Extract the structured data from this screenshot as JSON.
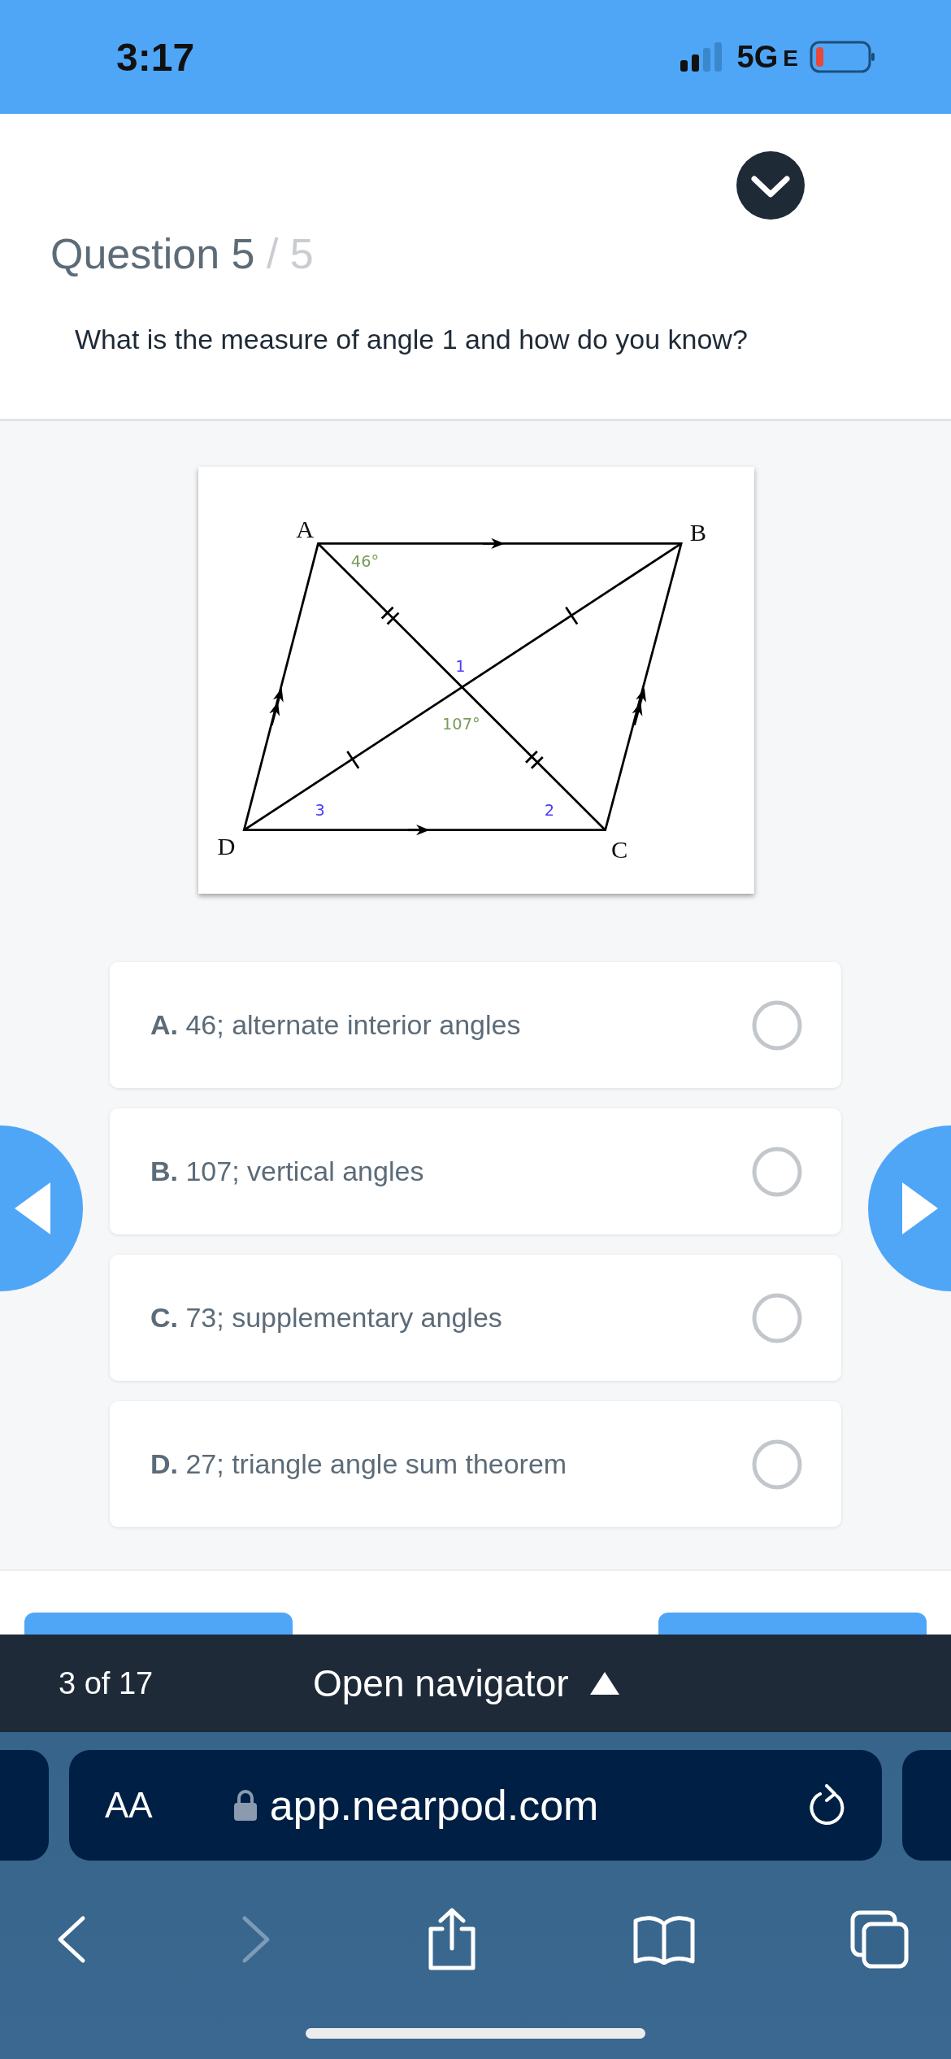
{
  "status_bar": {
    "time": "3:17",
    "network": "5G",
    "network_suffix": "E",
    "battery_low": true
  },
  "question": {
    "title": "Question 5",
    "total": "/ 5",
    "text": "What is the measure of angle 1 and how do you know?"
  },
  "figure": {
    "labels": [
      {
        "kind": "vertex",
        "text": "A"
      },
      {
        "kind": "vertex",
        "text": "B"
      },
      {
        "kind": "vertex",
        "text": "C"
      },
      {
        "kind": "vertex",
        "text": "D"
      },
      {
        "kind": "given",
        "text": "46°"
      },
      {
        "kind": "angle",
        "text": "1"
      },
      {
        "kind": "given",
        "text": "107°"
      },
      {
        "kind": "angle",
        "text": "3"
      },
      {
        "kind": "angle",
        "text": "2"
      }
    ]
  },
  "choices": [
    {
      "letter": "A.",
      "text": "46; alternate interior angles",
      "selected": false
    },
    {
      "letter": "B.",
      "text": "107; vertical angles",
      "selected": false
    },
    {
      "letter": "C.",
      "text": "73; supplementary angles",
      "selected": false
    },
    {
      "letter": "D.",
      "text": "27; triangle angle sum theorem",
      "selected": false
    }
  ],
  "navigator": {
    "counter": "3 of 17",
    "label": "Open navigator"
  },
  "browser": {
    "text_size": "AA",
    "url": "app.nearpod.com"
  }
}
